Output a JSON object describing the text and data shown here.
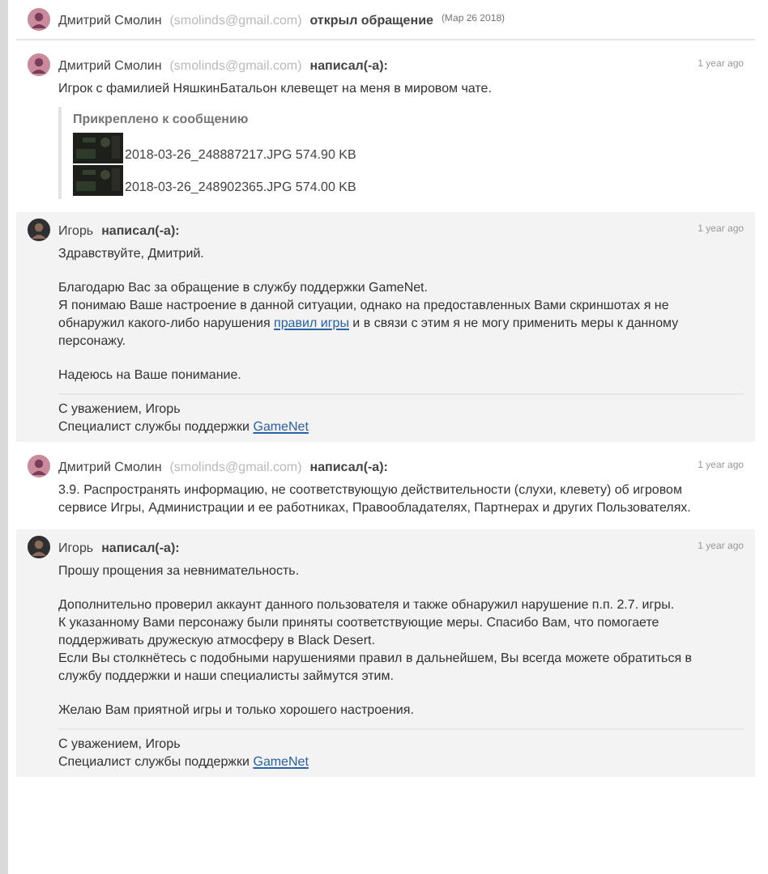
{
  "event": {
    "author": "Дмитрий Смолин",
    "email": "(smolinds@gmail.com)",
    "action": "открыл обращение",
    "date": "(Мар 26 2018)"
  },
  "messages": [
    {
      "author": "Дмитрий Смолин",
      "email": "(smolinds@gmail.com)",
      "action": "написал(-а):",
      "time": "1 year ago",
      "staff": false,
      "paragraphs": [
        [
          [
            {
              "kind": "text",
              "text": "Игрок с фамилией НяшкинБатальон клевещет на меня в мировом чате."
            }
          ]
        ]
      ],
      "attachments": {
        "title": "Прикреплено к сообщению",
        "files": [
          {
            "name": "2018-03-26_248887217.JPG",
            "size": "574.90 KB"
          },
          {
            "name": "2018-03-26_248902365.JPG",
            "size": "574.00 KB"
          }
        ]
      }
    },
    {
      "author": "Игорь",
      "action": "написал(-а):",
      "time": "1 year ago",
      "staff": true,
      "paragraphs": [
        [
          [
            {
              "kind": "text",
              "text": "Здравствуйте, Дмитрий."
            }
          ]
        ],
        [
          [
            {
              "kind": "text",
              "text": "Благодарю Вас за обращение в службу поддержки GameNet."
            }
          ],
          [
            {
              "kind": "text",
              "text": "Я понимаю Ваше настроение в данной ситуации, однако на предоставленных Вами скриншотах я не обнаружил какого-либо нарушения "
            },
            {
              "kind": "link",
              "text": "правил игры"
            },
            {
              "kind": "text",
              "text": " и в связи с этим я не могу применить меры к данному персонажу."
            }
          ]
        ],
        [
          [
            {
              "kind": "text",
              "text": "Надеюсь на Ваше понимание."
            }
          ]
        ]
      ],
      "signature": [
        [
          {
            "kind": "text",
            "text": "С уважением, Игорь"
          }
        ],
        [
          {
            "kind": "text",
            "text": "Специалист службы поддержки "
          },
          {
            "kind": "link",
            "text": "GameNet"
          }
        ]
      ]
    },
    {
      "author": "Дмитрий Смолин",
      "email": "(smolinds@gmail.com)",
      "action": "написал(-а):",
      "time": "1 year ago",
      "staff": false,
      "paragraphs": [
        [
          [
            {
              "kind": "text",
              "text": "3.9. Распространять информацию, не соответствующую действительности (слухи, клевету) об игровом сервисе Игры, Администрации и ее работниках, Правообладателях, Партнерах и других Пользователях."
            }
          ]
        ]
      ]
    },
    {
      "author": "Игорь",
      "action": "написал(-а):",
      "time": "1 year ago",
      "staff": true,
      "paragraphs": [
        [
          [
            {
              "kind": "text",
              "text": "Прошу прощения за невнимательность."
            }
          ]
        ],
        [
          [
            {
              "kind": "text",
              "text": "Дополнительно проверил аккаунт данного пользователя и также обнаружил нарушение п.п. 2.7. игры."
            }
          ],
          [
            {
              "kind": "text",
              "text": "К указанному Вами персонажу были приняты соответствующие меры. Спасибо Вам, что помогаете поддерживать дружескую атмосферу в Black Desert."
            }
          ],
          [
            {
              "kind": "text",
              "text": "Если Вы столкнётесь с подобными нарушениями правил в дальнейшем, Вы всегда можете обратиться в службу поддержки и наши специалисты займутся этим."
            }
          ]
        ],
        [
          [
            {
              "kind": "text",
              "text": "Желаю Вам приятной игры и только хорошего настроения."
            }
          ]
        ]
      ],
      "signature": [
        [
          {
            "kind": "text",
            "text": "С уважением, Игорь"
          }
        ],
        [
          {
            "kind": "text",
            "text": "Специалист службы поддержки "
          },
          {
            "kind": "link",
            "text": "GameNet"
          }
        ]
      ]
    }
  ]
}
